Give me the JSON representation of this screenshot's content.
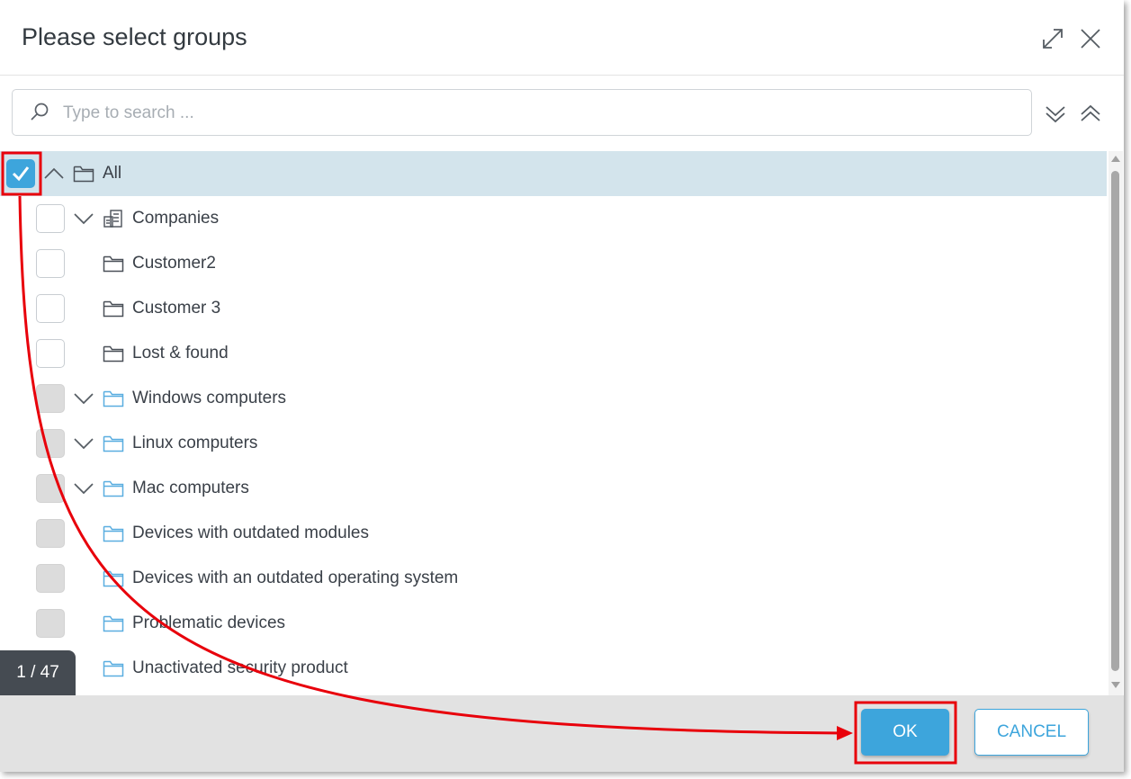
{
  "dialog": {
    "title": "Please select groups"
  },
  "search": {
    "placeholder": "Type to search ..."
  },
  "tree": {
    "items": [
      {
        "label": "All",
        "checked": true,
        "expander": "up",
        "icon": "folder-icon",
        "state": "selected"
      },
      {
        "label": "Companies",
        "checked": false,
        "expander": "down",
        "icon": "companies-icon",
        "state": "enabled"
      },
      {
        "label": "Customer2",
        "checked": false,
        "expander": "none",
        "icon": "folder-icon",
        "state": "enabled"
      },
      {
        "label": "Customer 3",
        "checked": false,
        "expander": "none",
        "icon": "folder-icon",
        "state": "enabled"
      },
      {
        "label": "Lost & found",
        "checked": false,
        "expander": "none",
        "icon": "folder-icon",
        "state": "enabled"
      },
      {
        "label": "Windows computers",
        "checked": false,
        "expander": "down",
        "icon": "dynamic-folder-icon",
        "state": "disabled"
      },
      {
        "label": "Linux computers",
        "checked": false,
        "expander": "down",
        "icon": "dynamic-folder-icon",
        "state": "disabled"
      },
      {
        "label": "Mac computers",
        "checked": false,
        "expander": "down",
        "icon": "dynamic-folder-icon",
        "state": "disabled"
      },
      {
        "label": "Devices with outdated modules",
        "checked": false,
        "expander": "none",
        "icon": "dynamic-folder-icon",
        "state": "disabled"
      },
      {
        "label": "Devices with an outdated operating system",
        "checked": false,
        "expander": "none",
        "icon": "dynamic-folder-icon",
        "state": "disabled"
      },
      {
        "label": "Problematic devices",
        "checked": false,
        "expander": "none",
        "icon": "dynamic-folder-icon",
        "state": "disabled"
      },
      {
        "label": "Unactivated security product",
        "checked": false,
        "expander": "none",
        "icon": "dynamic-folder-icon",
        "state": "disabled"
      }
    ]
  },
  "counter": {
    "text": "1 / 47"
  },
  "footer": {
    "ok_label": "OK",
    "cancel_label": "CANCEL"
  },
  "colors": {
    "accent": "#3da5dc",
    "selected_row": "#d3e4ec",
    "annotation": "#e8000b"
  }
}
